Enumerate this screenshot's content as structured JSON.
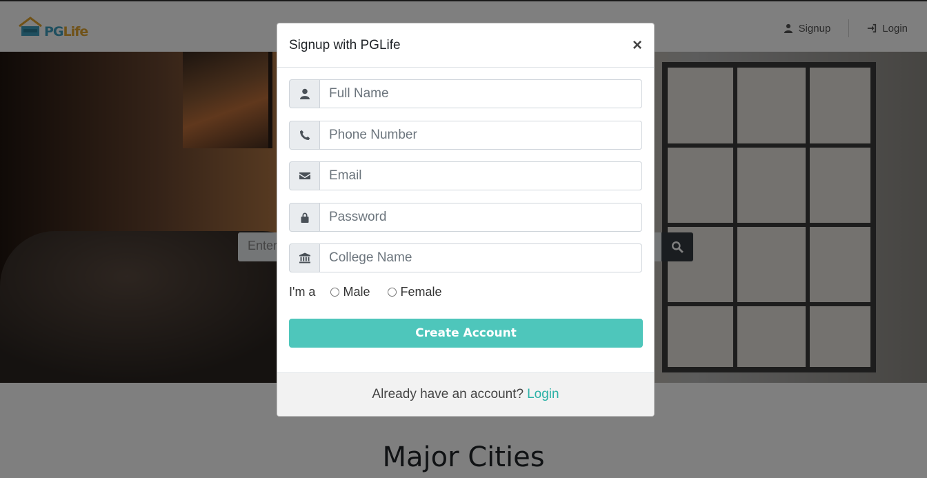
{
  "navbar": {
    "logo_pg": "PG",
    "logo_life": "Life",
    "signup_label": "Signup",
    "login_label": "Login"
  },
  "hero": {
    "search_placeholder": "Enter"
  },
  "sections": {
    "major_cities_title": "Major Cities"
  },
  "modal": {
    "title": "Signup with PGLife",
    "close_symbol": "×",
    "fields": {
      "full_name_placeholder": "Full Name",
      "phone_placeholder": "Phone Number",
      "email_placeholder": "Email",
      "password_placeholder": "Password",
      "college_placeholder": "College Name"
    },
    "gender": {
      "label": "I'm a",
      "options": [
        "Male",
        "Female"
      ]
    },
    "submit_label": "Create Account",
    "footer_text": "Already have an account?",
    "footer_link": "Login"
  },
  "colors": {
    "accent": "#4ec6bb",
    "link": "#2bb1a6",
    "backdrop": "rgba(0,0,0,0.5)"
  },
  "icons": [
    "user-icon",
    "sign-in-icon",
    "search-icon",
    "phone-icon",
    "envelope-icon",
    "lock-icon",
    "university-icon"
  ]
}
